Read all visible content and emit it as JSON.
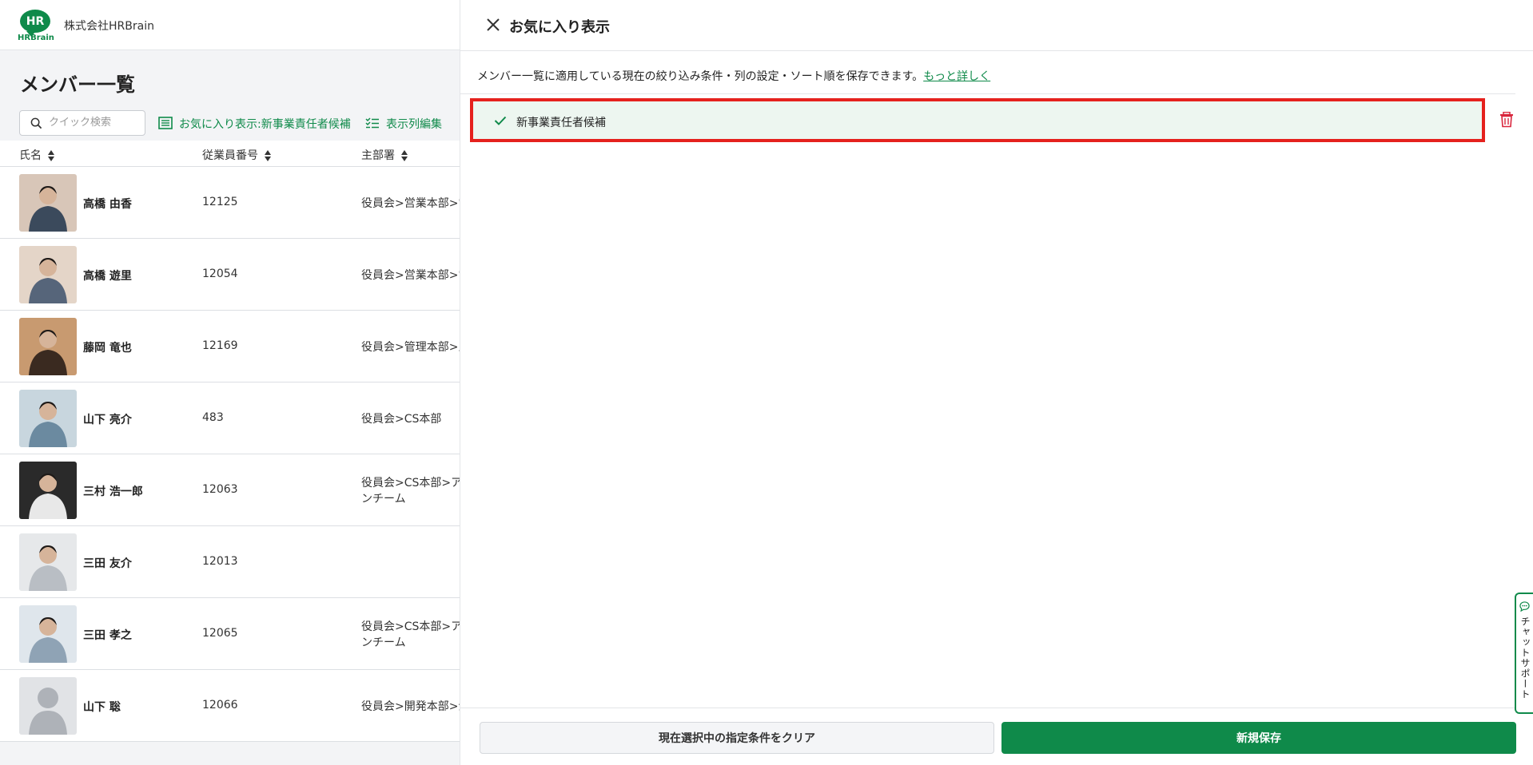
{
  "header": {
    "logo_mark": "HR",
    "logo_text": "HRBrain",
    "company": "株式会社HRBrain"
  },
  "page": {
    "title": "メンバー一覧"
  },
  "toolbar": {
    "search_placeholder": "クイック検索",
    "favorite_label": "お気に入り表示:新事業責任者候補",
    "columns_label": "表示列編集"
  },
  "table": {
    "columns": [
      "氏名",
      "従業員番号",
      "主部署"
    ],
    "rows": [
      {
        "name": "高橋 由香",
        "emp_no": "12125",
        "dept": [
          "役員会>営業本部>営"
        ]
      },
      {
        "name": "高橋 遊里",
        "emp_no": "12054",
        "dept": [
          "役員会>営業本部>営"
        ]
      },
      {
        "name": "藤岡 竜也",
        "emp_no": "12169",
        "dept": [
          "役員会>管理本部>人"
        ]
      },
      {
        "name": "山下 亮介",
        "emp_no": "483",
        "dept": [
          "役員会>CS本部"
        ]
      },
      {
        "name": "三村 浩一郎",
        "emp_no": "12063",
        "dept": [
          "役員会>CS本部>ア",
          "ンチーム"
        ]
      },
      {
        "name": "三田 友介",
        "emp_no": "12013",
        "dept": [
          ""
        ]
      },
      {
        "name": "三田 孝之",
        "emp_no": "12065",
        "dept": [
          "役員会>CS本部>ア",
          "ンチーム"
        ]
      },
      {
        "name": "山下 聡",
        "emp_no": "12066",
        "dept": [
          "役員会>開発本部>企"
        ]
      }
    ]
  },
  "drawer": {
    "title": "お気に入り表示",
    "description": "メンバー一覧に適用している現在の絞り込み条件・列の設定・ソート順を保存できます。",
    "learn_more": "もっと詳しく",
    "items": [
      {
        "label": "新事業責任者候補",
        "selected": true
      }
    ],
    "clear_button": "現在選択中の指定条件をクリア",
    "save_button": "新規保存"
  },
  "chat_support": {
    "label": "チャットサポート"
  },
  "colors": {
    "brand": "#0f8a4a",
    "highlight": "#e5211d",
    "danger": "#d9263d",
    "selected_bg": "#edf6f0"
  }
}
